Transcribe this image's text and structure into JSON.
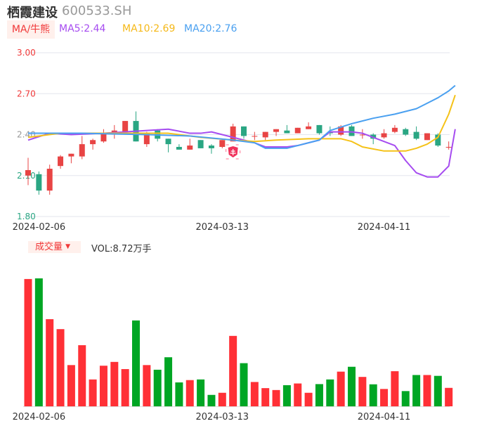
{
  "header": {
    "name": "栖霞建设",
    "code": "600533.SH"
  },
  "ma_bar": {
    "tab": "MA/牛熊",
    "ma5": "MA5:2.44",
    "ma10": "MA10:2.69",
    "ma20": "MA20:2.76"
  },
  "volume_bar": {
    "tab": "成交量",
    "dropdown_icon": "triangle-down",
    "vol": "VOL:8.72万手"
  },
  "colors": {
    "up": "#e84444",
    "down": "#2aa683",
    "vol_up": "#ff3036",
    "vol_down": "#00a624",
    "ma5": "#a64cf0",
    "ma10": "#f5c218",
    "ma20": "#4aa0f0"
  },
  "chart_data": [
    {
      "type": "candlestick",
      "y_ticks": [
        "3.00",
        "2.70",
        "2.40",
        "2.10",
        "1.80"
      ],
      "ylim": [
        1.8,
        3.0
      ],
      "x_ticks": [
        {
          "index": 1,
          "label": "2024-02-06"
        },
        {
          "index": 18,
          "label": "2024-03-13"
        },
        {
          "index": 33,
          "label": "2024-04-11"
        }
      ],
      "ohlc": [
        [
          2.1,
          2.23,
          2.03,
          2.14
        ],
        [
          2.11,
          2.13,
          1.96,
          1.99
        ],
        [
          1.99,
          2.18,
          1.96,
          2.15
        ],
        [
          2.17,
          2.25,
          2.15,
          2.24
        ],
        [
          2.24,
          2.26,
          2.19,
          2.26
        ],
        [
          2.24,
          2.39,
          2.22,
          2.33
        ],
        [
          2.33,
          2.37,
          2.29,
          2.36
        ],
        [
          2.35,
          2.44,
          2.34,
          2.41
        ],
        [
          2.4,
          2.47,
          2.37,
          2.43
        ],
        [
          2.42,
          2.5,
          2.4,
          2.5
        ],
        [
          2.5,
          2.57,
          2.35,
          2.35
        ],
        [
          2.33,
          2.42,
          2.31,
          2.41
        ],
        [
          2.43,
          2.44,
          2.35,
          2.37
        ],
        [
          2.37,
          2.37,
          2.27,
          2.33
        ],
        [
          2.31,
          2.33,
          2.29,
          2.29
        ],
        [
          2.29,
          2.37,
          2.29,
          2.32
        ],
        [
          2.36,
          2.36,
          2.3,
          2.3
        ],
        [
          2.32,
          2.33,
          2.26,
          2.3
        ],
        [
          2.31,
          2.36,
          2.3,
          2.36
        ],
        [
          2.35,
          2.48,
          2.35,
          2.46
        ],
        [
          2.46,
          2.46,
          2.37,
          2.39
        ],
        [
          2.39,
          2.42,
          2.36,
          2.39
        ],
        [
          2.38,
          2.42,
          2.36,
          2.42
        ],
        [
          2.42,
          2.44,
          2.39,
          2.44
        ],
        [
          2.43,
          2.47,
          2.41,
          2.41
        ],
        [
          2.41,
          2.45,
          2.41,
          2.45
        ],
        [
          2.44,
          2.49,
          2.44,
          2.46
        ],
        [
          2.47,
          2.47,
          2.4,
          2.41
        ],
        [
          2.42,
          2.46,
          2.39,
          2.41
        ],
        [
          2.4,
          2.47,
          2.39,
          2.46
        ],
        [
          2.46,
          2.47,
          2.39,
          2.39
        ],
        [
          2.4,
          2.44,
          2.37,
          2.4
        ],
        [
          2.4,
          2.41,
          2.33,
          2.37
        ],
        [
          2.38,
          2.44,
          2.37,
          2.41
        ],
        [
          2.42,
          2.47,
          2.41,
          2.45
        ],
        [
          2.44,
          2.45,
          2.39,
          2.4
        ],
        [
          2.42,
          2.46,
          2.36,
          2.37
        ],
        [
          2.36,
          2.41,
          2.36,
          2.41
        ],
        [
          2.4,
          2.41,
          2.31,
          2.32
        ],
        [
          2.31,
          2.35,
          2.29,
          2.31
        ]
      ],
      "ma_series": [
        {
          "name": "MA5",
          "points": [
            [
              0,
              2.36
            ],
            [
              2,
              2.41
            ],
            [
              4,
              2.4
            ],
            [
              7,
              2.41
            ],
            [
              9,
              2.42
            ],
            [
              11,
              2.43
            ],
            [
              13,
              2.44
            ],
            [
              15,
              2.41
            ],
            [
              16,
              2.41
            ],
            [
              17,
              2.42
            ],
            [
              18,
              2.4
            ],
            [
              20,
              2.36
            ],
            [
              21,
              2.34
            ],
            [
              22,
              2.31
            ],
            [
              24,
              2.31
            ],
            [
              25,
              2.32
            ],
            [
              26,
              2.34
            ],
            [
              27,
              2.36
            ],
            [
              28,
              2.42
            ],
            [
              30,
              2.42
            ],
            [
              31,
              2.41
            ],
            [
              32,
              2.38
            ],
            [
              34,
              2.32
            ],
            [
              35,
              2.21
            ],
            [
              36,
              2.12
            ],
            [
              37,
              2.09
            ],
            [
              38,
              2.09
            ],
            [
              39,
              2.17
            ],
            [
              39.6,
              2.44
            ]
          ]
        },
        {
          "name": "MA10",
          "points": [
            [
              0,
              2.38
            ],
            [
              3,
              2.41
            ],
            [
              6,
              2.41
            ],
            [
              13,
              2.41
            ],
            [
              14,
              2.4
            ],
            [
              16,
              2.38
            ],
            [
              19,
              2.36
            ],
            [
              21,
              2.35
            ],
            [
              23,
              2.36
            ],
            [
              26,
              2.37
            ],
            [
              29,
              2.37
            ],
            [
              30,
              2.35
            ],
            [
              31,
              2.31
            ],
            [
              33,
              2.28
            ],
            [
              35,
              2.28
            ],
            [
              36,
              2.3
            ],
            [
              37,
              2.33
            ],
            [
              38,
              2.38
            ],
            [
              39,
              2.55
            ],
            [
              39.6,
              2.69
            ]
          ]
        },
        {
          "name": "MA20",
          "points": [
            [
              0,
              2.41
            ],
            [
              5,
              2.41
            ],
            [
              11,
              2.4
            ],
            [
              15,
              2.39
            ],
            [
              19,
              2.36
            ],
            [
              21,
              2.34
            ],
            [
              22,
              2.3
            ],
            [
              24,
              2.3
            ],
            [
              26,
              2.34
            ],
            [
              27,
              2.36
            ],
            [
              28,
              2.43
            ],
            [
              30,
              2.48
            ],
            [
              32,
              2.52
            ],
            [
              34,
              2.55
            ],
            [
              36,
              2.59
            ],
            [
              37,
              2.63
            ],
            [
              38,
              2.67
            ],
            [
              39,
              2.72
            ],
            [
              39.6,
              2.76
            ]
          ]
        }
      ]
    },
    {
      "type": "bar",
      "title": "成交量",
      "unit": "万手",
      "values": [
        60.2,
        60.5,
        41.2,
        36.5,
        19.5,
        28.9,
        12.7,
        19.2,
        21.0,
        17.6,
        40.6,
        19.5,
        17.3,
        23.2,
        11.3,
        12.4,
        12.7,
        5.4,
        6.4,
        33.3,
        20.4,
        11.5,
        8.6,
        7.7,
        10.0,
        10.8,
        6.4,
        10.5,
        12.7,
        16.4,
        18.7,
        13.9,
        10.4,
        8.2,
        16.6,
        7.2,
        14.8,
        14.8,
        14.4,
        8.72
      ],
      "x_ticks": [
        {
          "index": 1,
          "label": "2024-02-06"
        },
        {
          "index": 18,
          "label": "2024-03-13"
        },
        {
          "index": 33,
          "label": "2024-04-11"
        }
      ]
    }
  ]
}
